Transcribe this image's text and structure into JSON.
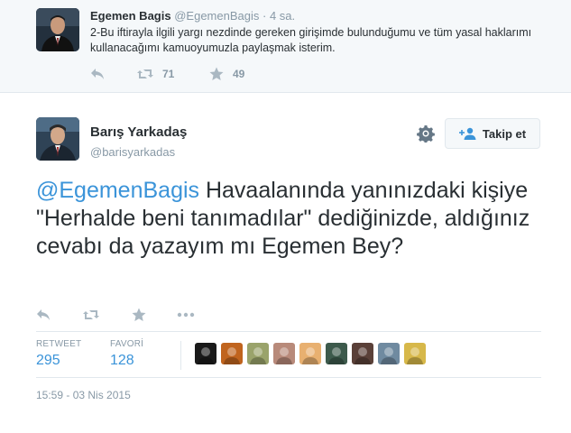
{
  "parent_tweet": {
    "name": "Egemen Bagis",
    "handle": "@EgemenBagis",
    "separator": "·",
    "time": "4 sa.",
    "text": "2-Bu iftirayla ilgili yargı nezdinde gereken girişimde bulunduğumu ve tüm yasal haklarımı kullanacağımı kamuoyumuzla paylaşmak isterim.",
    "retweet_count": "71",
    "favorite_count": "49"
  },
  "main_tweet": {
    "name": "Barış Yarkadaş",
    "handle": "@barisyarkadas",
    "follow_label": "Takip et",
    "mention": "@EgemenBagis",
    "text": " Havaalanında yanınızdaki kişiye \"Herhalde beni tanımadılar\" dediğinizde, aldığınız cevabı da yazayım mı Egemen Bey?",
    "stats": {
      "retweet_label": "RETWEET",
      "retweet_count": "295",
      "favorite_label": "FAVORİ",
      "favorite_count": "128"
    },
    "timestamp": "15:59 - 03 Nis 2015"
  },
  "colors": {
    "link": "#3b94d9",
    "muted": "#8899a6",
    "icon": "#aab8c2",
    "text": "#292f33",
    "border": "#e1e8ed",
    "parent_bg": "#f5f8fa"
  },
  "icons": {
    "reply": "reply-icon",
    "retweet": "retweet-icon",
    "favorite": "star-icon",
    "more": "more-dots-icon",
    "settings": "gear-icon",
    "follow": "add-user-icon"
  },
  "favoriters": [
    {
      "color": "#1a1a1a"
    },
    {
      "color": "#c0641e"
    },
    {
      "color": "#9aa36b"
    },
    {
      "color": "#b88a7a"
    },
    {
      "color": "#e8b070"
    },
    {
      "color": "#3d5a4c"
    },
    {
      "color": "#5a4038"
    },
    {
      "color": "#6f8aa0"
    },
    {
      "color": "#d7b84a"
    }
  ]
}
